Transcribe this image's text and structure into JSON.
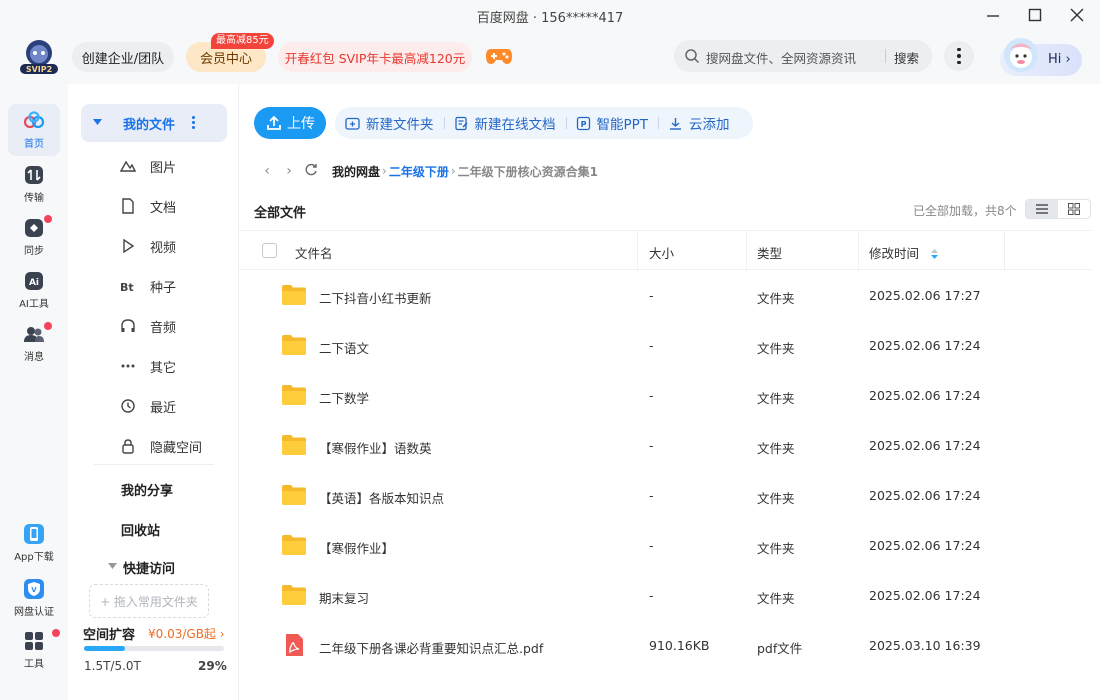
{
  "window": {
    "title": "百度网盘 · 156*****417"
  },
  "header": {
    "logo_text": "SVIP2",
    "team_label": "创建企业/团队",
    "vip_label": "会员中心",
    "vip_badge": "最高减85元",
    "promo_label": "开春红包 SVIP年卡最高减120元",
    "search_placeholder": "搜网盘文件、全网资源资讯",
    "search_button": "搜索",
    "greeting": "Hi",
    "accent_color": "#1a9af3"
  },
  "rail": {
    "items": [
      {
        "label": "首页",
        "icon": "home-cloud-icon"
      },
      {
        "label": "传输",
        "icon": "transfer-icon"
      },
      {
        "label": "同步",
        "icon": "sync-icon"
      },
      {
        "label": "AI工具",
        "icon": "ai-tool-icon"
      },
      {
        "label": "消息",
        "icon": "message-icon"
      },
      {
        "label": "App下载",
        "icon": "phone-icon"
      },
      {
        "label": "网盘认证",
        "icon": "verify-icon"
      },
      {
        "label": "工具",
        "icon": "tools-icon"
      }
    ]
  },
  "nav": {
    "my_files": "我的文件",
    "items": [
      {
        "label": "图片",
        "icon": "picture-icon"
      },
      {
        "label": "文档",
        "icon": "document-icon"
      },
      {
        "label": "视频",
        "icon": "video-icon"
      },
      {
        "label": "种子",
        "icon": "torrent-icon"
      },
      {
        "label": "音频",
        "icon": "audio-icon"
      },
      {
        "label": "其它",
        "icon": "other-icon"
      },
      {
        "label": "最近",
        "icon": "recent-icon"
      },
      {
        "label": "隐藏空间",
        "icon": "lock-icon"
      }
    ],
    "share": "我的分享",
    "recycle": "回收站",
    "quick_access": "快捷访问",
    "drop_hint": "+ 拖入常用文件夹",
    "space_title": "空间扩容",
    "space_price": "¥0.03/GB起",
    "space_used": "1.5T/5.0T",
    "space_percent": "29%",
    "space_fraction": 0.29
  },
  "toolbar": {
    "upload": "上传",
    "new_folder": "新建文件夹",
    "new_doc": "新建在线文档",
    "smart_ppt": "智能PPT",
    "cloud_add": "云添加"
  },
  "breadcrumb": {
    "root": "我的网盘",
    "level1": "二年级下册",
    "level2": "二年级下册核心资源合集1"
  },
  "list": {
    "title": "全部文件",
    "status": "已全部加载，共8个",
    "columns": {
      "name": "文件名",
      "size": "大小",
      "type": "类型",
      "modified": "修改时间"
    },
    "rows": [
      {
        "name": "二下抖音小红书更新",
        "size": "-",
        "type": "文件夹",
        "time": "2025.02.06 17:27",
        "icon": "folder-icon"
      },
      {
        "name": "二下语文",
        "size": "-",
        "type": "文件夹",
        "time": "2025.02.06 17:24",
        "icon": "folder-icon"
      },
      {
        "name": "二下数学",
        "size": "-",
        "type": "文件夹",
        "time": "2025.02.06 17:24",
        "icon": "folder-icon"
      },
      {
        "name": "【寒假作业】语数英",
        "size": "-",
        "type": "文件夹",
        "time": "2025.02.06 17:24",
        "icon": "folder-icon"
      },
      {
        "name": "【英语】各版本知识点",
        "size": "-",
        "type": "文件夹",
        "time": "2025.02.06 17:24",
        "icon": "folder-icon"
      },
      {
        "name": "【寒假作业】",
        "size": "-",
        "type": "文件夹",
        "time": "2025.02.06 17:24",
        "icon": "folder-icon"
      },
      {
        "name": "期末复习",
        "size": "-",
        "type": "文件夹",
        "time": "2025.02.06 17:24",
        "icon": "folder-icon"
      },
      {
        "name": "二年级下册各课必背重要知识点汇总.pdf",
        "size": "910.16KB",
        "type": "pdf文件",
        "time": "2025.03.10 16:39",
        "icon": "pdf-icon"
      }
    ]
  }
}
